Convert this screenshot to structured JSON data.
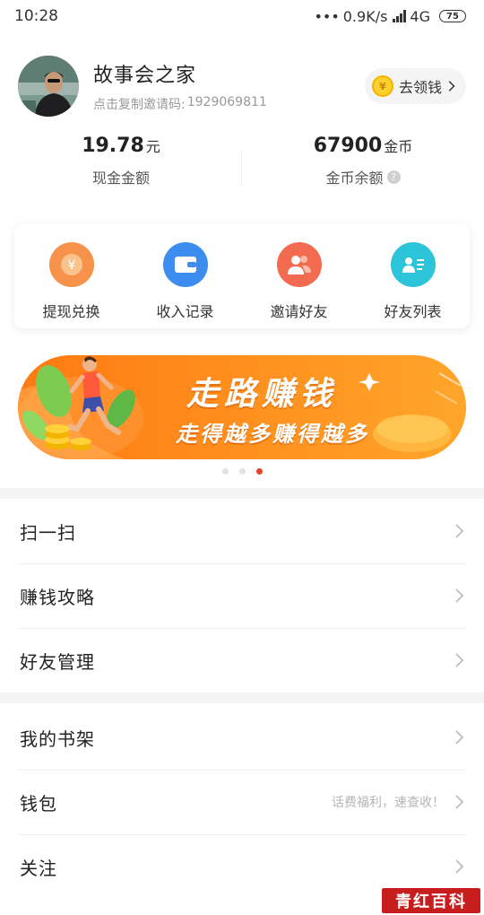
{
  "status_bar": {
    "time": "10:28",
    "network_speed": "0.9K/s",
    "network_type": "4G",
    "battery": "75"
  },
  "profile": {
    "username": "故事会之家",
    "invite_prefix": "点击复制邀请码:",
    "invite_code": "1929069811",
    "earn_button": "去领钱",
    "coin_icon": "yuan-coin-icon"
  },
  "balances": {
    "cash": {
      "value": "19.78",
      "unit": "元",
      "label": "现金金额"
    },
    "coins": {
      "value": "67900",
      "unit": "金币",
      "label": "金币余额"
    }
  },
  "actions": [
    {
      "label": "提现兑换",
      "icon": "yuan-coin-icon",
      "color": "#f7924a"
    },
    {
      "label": "收入记录",
      "icon": "wallet-icon",
      "color": "#3d8cf0"
    },
    {
      "label": "邀请好友",
      "icon": "friends-icon",
      "color": "#f26a4f"
    },
    {
      "label": "好友列表",
      "icon": "contact-list-icon",
      "color": "#2bc4d8"
    }
  ],
  "banner": {
    "title": "走路赚钱",
    "subtitle": "走得越多赚得越多",
    "slide_count": 3,
    "active_slide": 3,
    "colors": {
      "start": "#ff8a1f",
      "end": "#ffa727",
      "accent": "#e8442c"
    }
  },
  "menu_groups": [
    [
      {
        "label": "扫一扫",
        "hint": ""
      },
      {
        "label": "赚钱攻略",
        "hint": ""
      },
      {
        "label": "好友管理",
        "hint": ""
      }
    ],
    [
      {
        "label": "我的书架",
        "hint": ""
      },
      {
        "label": "钱包",
        "hint": "话费福利，速查收！"
      },
      {
        "label": "关注",
        "hint": ""
      }
    ]
  ],
  "watermark": "青红百科"
}
